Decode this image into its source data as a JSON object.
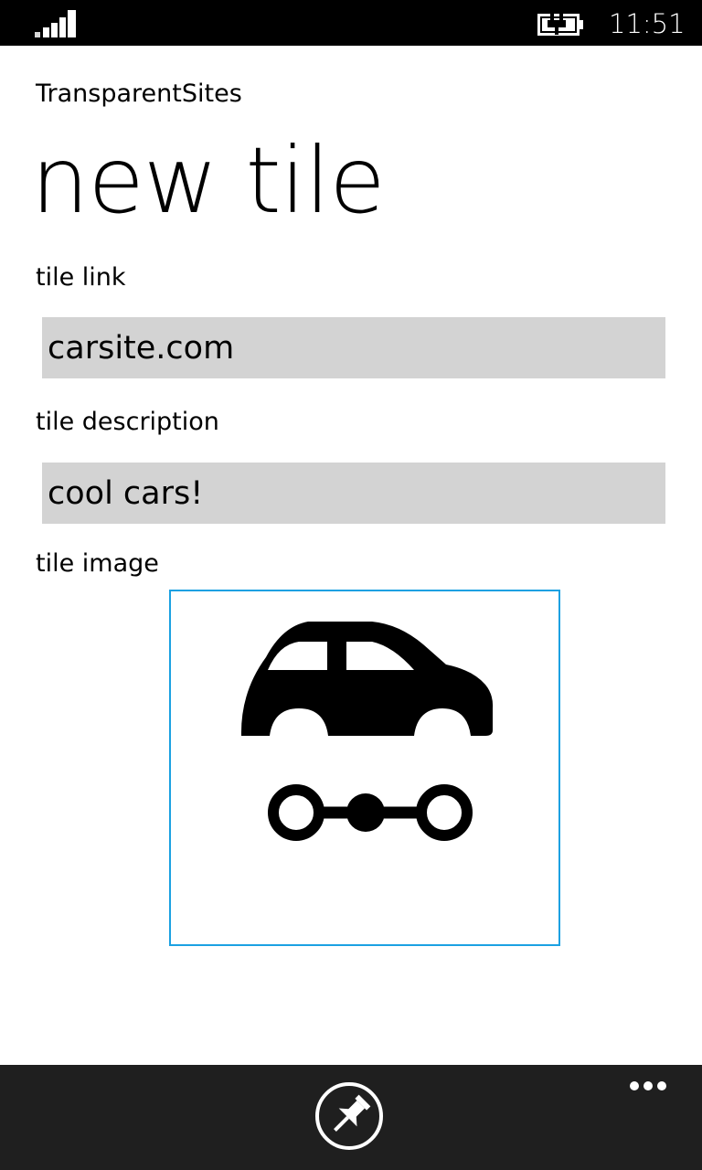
{
  "status_bar": {
    "time": "11:51",
    "signal_icon": "signal-strength-icon",
    "battery_icon": "battery-charging-icon"
  },
  "app": {
    "name": "TransparentSites"
  },
  "page": {
    "title": "new tile"
  },
  "form": {
    "tile_link": {
      "label": "tile link",
      "value": "carsite.com"
    },
    "tile_description": {
      "label": "tile description",
      "value": "cool cars!"
    },
    "tile_image": {
      "label": "tile image",
      "icon": "car-icon",
      "border_color": "#1ba1e2"
    }
  },
  "app_bar": {
    "pin_icon": "pin-icon",
    "more_icon": "ellipsis-icon",
    "background": "#1f1f1f"
  }
}
